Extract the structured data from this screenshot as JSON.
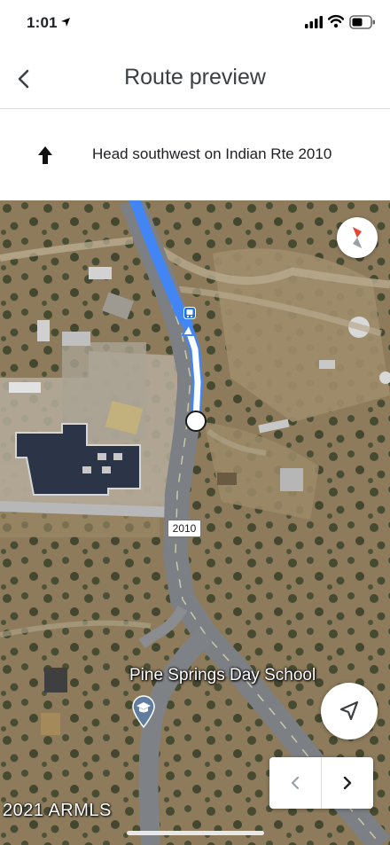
{
  "status_bar": {
    "time": "1:01"
  },
  "header": {
    "title": "Route preview"
  },
  "step": {
    "instruction": "Head southwest on Indian Rte 2010"
  },
  "map": {
    "route_shield": "2010",
    "poi_name": "Pine Springs Day School",
    "copyright": "2021 ARMLS",
    "route_color": "#4285f4",
    "icons": [
      "back-icon",
      "up-arrow-icon",
      "compass-icon",
      "bus-stop-icon",
      "school-pin-icon",
      "navigation-arrow-icon",
      "chevron-left-icon",
      "chevron-right-icon"
    ]
  }
}
